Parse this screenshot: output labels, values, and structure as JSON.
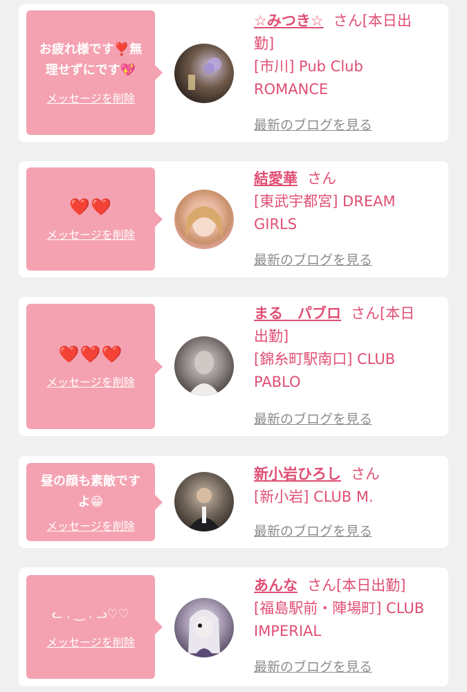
{
  "colors": {
    "accent": "#e04e73",
    "bubble": "#f4a2b1",
    "background": "#f0f0f0",
    "link_gray": "#8c8c8c"
  },
  "items": [
    {
      "message_lines": [
        "お疲れ様です❣️無",
        "理せずにです💖"
      ],
      "delete_label": "メッセージを削除",
      "name": "☆みつき☆",
      "suffix": "さん[本日出",
      "info_lines": [
        "勤]",
        "[市川] Pub Club",
        "ROMANCE"
      ],
      "blog_label": "最新のブログを見る",
      "avatar_icon": "portrait-photo"
    },
    {
      "message_lines": [
        "❤️❤️"
      ],
      "delete_label": "メッセージを削除",
      "name": "結愛華",
      "suffix": "さん",
      "info_lines": [
        "[東武宇都宮] DREAM",
        "GIRLS"
      ],
      "blog_label": "最新のブログを見る",
      "avatar_icon": "portrait-photo"
    },
    {
      "message_lines": [
        "❤️❤️❤️"
      ],
      "delete_label": "メッセージを削除",
      "name": "まる　パブロ",
      "suffix": "さん[本日",
      "info_lines": [
        "出勤]",
        "[錦糸町駅南口] CLUB",
        "PABLO"
      ],
      "blog_label": "最新のブログを見る",
      "avatar_icon": "portrait-photo"
    },
    {
      "message_lines": [
        "昼の顔も素敵です",
        "よ😁"
      ],
      "delete_label": "メッセージを削除",
      "name": "新小岩ひろし",
      "suffix": "さん",
      "info_lines": [
        "[新小岩] CLUB M."
      ],
      "blog_label": "最新のブログを見る",
      "avatar_icon": "portrait-photo"
    },
    {
      "message_lines": [
        "ᓚ . ‿ . ᓗ♡♡"
      ],
      "delete_label": "メッセージを削除",
      "name": "あんな",
      "suffix": "さん[本日出勤]",
      "info_lines": [
        "[福島駅前・陣場町] CLUB",
        "IMPERIAL"
      ],
      "blog_label": "最新のブログを見る",
      "avatar_icon": "portrait-photo"
    }
  ]
}
